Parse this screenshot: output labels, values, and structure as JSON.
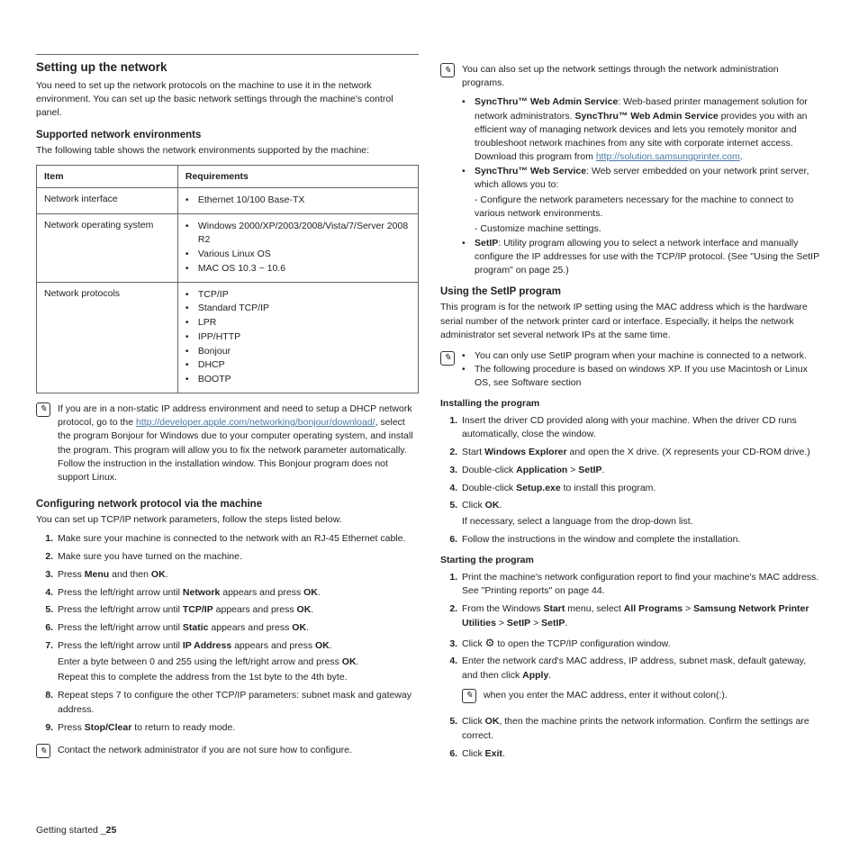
{
  "leftCol": {
    "sectionTitle": "Setting up the network",
    "intro": "You need to set up the network protocols on the machine to use it in the network environment. You can set up the basic network settings through the machine's control panel.",
    "envTitle": "Supported network environments",
    "envText": "The following table shows the network environments supported by the machine:",
    "table": {
      "h1": "Item",
      "h2": "Requirements",
      "r1c1": "Network interface",
      "r1c2": [
        "Ethernet 10/100 Base-TX"
      ],
      "r2c1": "Network operating system",
      "r2c2": [
        "Windows 2000/XP/2003/2008/Vista/7/Server 2008 R2",
        "Various Linux OS",
        "MAC OS 10.3 ~ 10.6"
      ],
      "r3c1": "Network protocols",
      "r3c2": [
        "TCP/IP",
        "Standard TCP/IP",
        "LPR",
        "IPP/HTTP",
        "Bonjour",
        "DHCP",
        "BOOTP"
      ]
    },
    "bonjour": {
      "t1": "If you are in a non-static IP address environment and need to setup a DHCP network protocol, go to the ",
      "link": "http://developer.apple.com/networking/bonjour/download/",
      "t2": ", select the program Bonjour for Windows due to your computer operating system, and install the program. This program will allow you to fix the network parameter automatically. Follow the instruction in the installation window. This Bonjour program does not support Linux."
    },
    "cfgTitle": "Configuring network protocol via the machine",
    "cfgText": "You can set up TCP/IP network parameters, follow the steps listed below.",
    "steps": [
      "Make sure your machine is connected to the network with an RJ-45 Ethernet cable.",
      "Make sure you have turned on the machine.",
      "s3",
      "s4",
      "s5",
      "s6",
      "s7",
      "Repeat steps 7 to configure the other TCP/IP parameters: subnet mask and gateway address.",
      "s9"
    ],
    "s3a": "Press ",
    "s3b": "Menu",
    "s3c": " and then ",
    "s3d": "OK",
    "s3e": ".",
    "s4a": "Press the left/right arrow until ",
    "s4b": "Network",
    "s4c": " appears and press ",
    "s4d": "OK",
    "s4e": ".",
    "s5a": "Press the left/right arrow until ",
    "s5b": "TCP/IP",
    "s5c": " appears and press ",
    "s5d": "OK",
    "s5e": ".",
    "s6a": "Press the left/right arrow until ",
    "s6b": "Static",
    "s6c": " appears and press ",
    "s6d": "OK",
    "s6e": ".",
    "s7a": "Press the left/right arrow until ",
    "s7b": "IP Address",
    "s7c": " appears and press ",
    "s7d": "OK",
    "s7e": ".",
    "s7f": "Enter a byte between 0 and 255 using the left/right arrow and press ",
    "s7g": "OK",
    "s7h": ".",
    "s7i": "Repeat this to complete the address from the 1st byte to the 4th byte.",
    "s9a": "Press ",
    "s9b": "Stop/Clear",
    "s9c": " to return to ready mode.",
    "contactNote": "Contact the network administrator if you are not sure how to configure."
  },
  "rightCol": {
    "noteTop": {
      "lead": "You can also set up the network settings through the network administration programs.",
      "i1a": "SyncThru™ Web Admin Service",
      "i1b": ": Web-based printer management solution for network administrators. ",
      "i1c": "SyncThru™ Web Admin Service",
      "i1d": " provides you with an efficient way of managing network devices and lets you remotely monitor and troubleshoot network machines from any site with corporate internet access. Download this program from ",
      "i1link": "http://solution.samsungprinter.com",
      "i1e": ".",
      "i2a": "SyncThru™ Web Service",
      "i2b": ": Web server embedded on your network print server, which allows you to:",
      "i2c": "- Configure the network parameters necessary for the machine to connect to various network environments.",
      "i2d": "- Customize machine settings.",
      "i3a": "SetIP",
      "i3b": ": Utility program allowing you to select a network interface and manually configure the IP addresses for use with the TCP/IP protocol. (See \"Using the SetIP program\" on page 25.)"
    },
    "setipTitle": "Using the SetIP program",
    "setipPara": "This program is for the network IP setting using the MAC address which is the hardware serial number of the network printer card or interface. Especially, it helps the network administrator set several network IPs at the same time.",
    "setipNote": {
      "n1": "You can only use SetIP program when your machine is connected to a network.",
      "n2": "The following procedure is based on windows XP. If you use Macintosh or Linux OS, see Software section"
    },
    "installTitle": "Installing the program",
    "install": {
      "s1": "Insert the driver CD provided along with your machine. When the driver CD runs automatically, close the window.",
      "s2a": "Start ",
      "s2b": "Windows Explorer",
      "s2c": " and open the X drive. (X represents your CD-ROM drive.)",
      "s3a": "Double-click ",
      "s3b": "Application",
      "s3c": " > ",
      "s3d": "SetIP",
      "s3e": ".",
      "s4a": "Double-click ",
      "s4b": "Setup.exe",
      "s4c": " to install this program.",
      "s5a": "Click ",
      "s5b": "OK",
      "s5c": ".",
      "s5d": "If necessary, select a language from the drop-down list.",
      "s6": "Follow the instructions in the window and complete the installation."
    },
    "startTitle": "Starting the program",
    "start": {
      "s1a": "Print the machine's network configuration report to find your machine's MAC address. See \"Printing reports\" on page 44.",
      "s2a": "From the Windows ",
      "s2b": "Start",
      "s2c": " menu, select ",
      "s2d": "All Programs",
      "s2e": " > ",
      "s2f": "Samsung Network Printer Utilities",
      "s2g": " > ",
      "s2h": "SetIP",
      "s2i": " > ",
      "s2j": "SetIP",
      "s2k": ".",
      "s3a": "Click ",
      "s3b": " to open the TCP/IP configuration window.",
      "s4a": "Enter the network card's MAC address, IP address, subnet mask, default gateway, and then click ",
      "s4b": "Apply",
      "s4c": ".",
      "s4note": "when you enter the MAC address, enter it without colon(:).",
      "s5a": "Click ",
      "s5b": "OK",
      "s5c": ", then the machine prints the network information. Confirm the settings are correct.",
      "s6a": "Click ",
      "s6b": "Exit",
      "s6c": "."
    }
  },
  "footer": {
    "label": "Getting started",
    "page": "25"
  }
}
